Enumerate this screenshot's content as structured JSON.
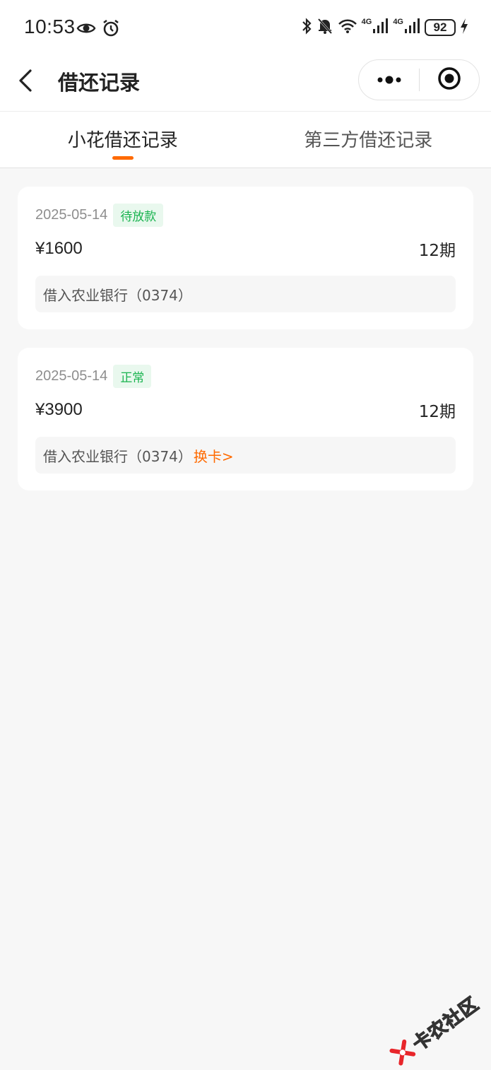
{
  "status_bar": {
    "time": "10:53",
    "network_label_1": "4G",
    "network_label_2": "4G",
    "battery": "92",
    "icons": [
      "eye-icon",
      "alarm-icon",
      "bluetooth-icon",
      "bell-off-icon",
      "wifi-icon",
      "signal-icon",
      "signal-icon",
      "battery-icon",
      "charging-icon"
    ]
  },
  "navbar": {
    "title": "借还记录",
    "back_icon": "chevron-left-icon",
    "more_icon": "more-dots-icon",
    "close_icon": "target-close-icon"
  },
  "tabs": [
    {
      "label": "小花借还记录",
      "active": true
    },
    {
      "label": "第三方借还记录",
      "active": false
    }
  ],
  "records": [
    {
      "date": "2025-05-14",
      "status": "待放款",
      "amount": "¥1600",
      "term": "12期",
      "bank": "借入农业银行（0374）",
      "action": ""
    },
    {
      "date": "2025-05-14",
      "status": "正常",
      "amount": "¥3900",
      "term": "12期",
      "bank": "借入农业银行（0374）",
      "action": "换卡>"
    }
  ],
  "watermark": {
    "text": "卡农社区"
  },
  "colors": {
    "accent": "#ff6a00",
    "badge_text": "#19b34f",
    "badge_bg": "#e9f8ee",
    "page_bg": "#f7f7f7"
  }
}
